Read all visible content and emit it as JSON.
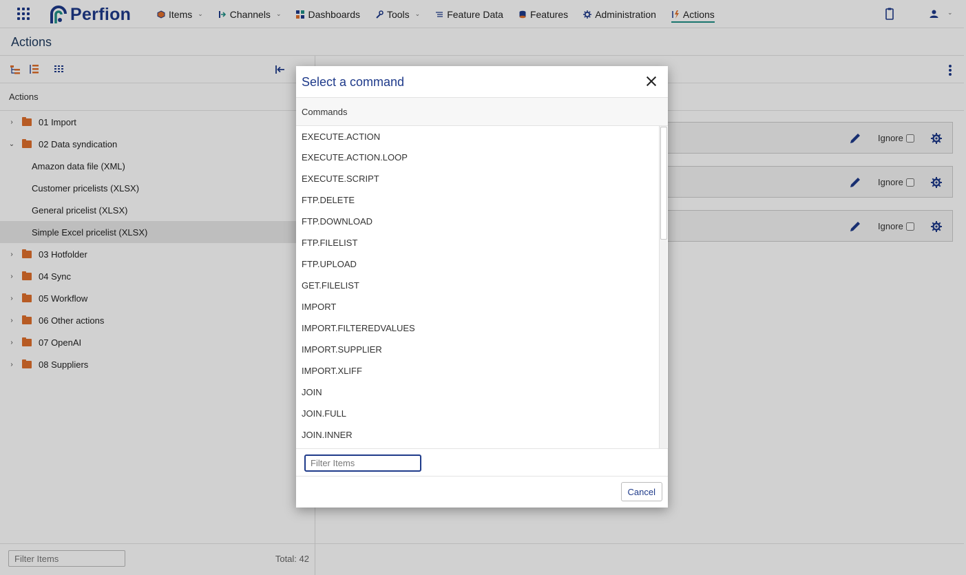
{
  "app": {
    "brand": "Perfion",
    "accent_color": "#1f8f86",
    "brand_color": "#1e3a8a"
  },
  "nav": {
    "items": [
      {
        "label": "Items",
        "icon": "cube-icon",
        "has_dropdown": true
      },
      {
        "label": "Channels",
        "icon": "channel-arrow-icon",
        "has_dropdown": true
      },
      {
        "label": "Dashboards",
        "icon": "dashboard-grid-icon",
        "has_dropdown": false
      },
      {
        "label": "Tools",
        "icon": "wrench-icon",
        "has_dropdown": true
      },
      {
        "label": "Feature Data",
        "icon": "list-icon",
        "has_dropdown": false
      },
      {
        "label": "Features",
        "icon": "database-icon",
        "has_dropdown": false
      },
      {
        "label": "Administration",
        "icon": "gear-icon",
        "has_dropdown": false
      },
      {
        "label": "Actions",
        "icon": "actions-bolt-icon",
        "has_dropdown": false,
        "active": true
      }
    ]
  },
  "page": {
    "title": "Actions"
  },
  "left_panel": {
    "header": "Actions",
    "tree": [
      {
        "label": "01 Import",
        "type": "folder",
        "expanded": false
      },
      {
        "label": "02 Data syndication",
        "type": "folder",
        "expanded": true
      },
      {
        "label": "Amazon data file (XML)",
        "type": "action"
      },
      {
        "label": "Customer pricelists (XLSX)",
        "type": "action"
      },
      {
        "label": "General pricelist (XLSX)",
        "type": "action"
      },
      {
        "label": "Simple Excel pricelist (XLSX)",
        "type": "action",
        "selected": true
      },
      {
        "label": "03 Hotfolder",
        "type": "folder",
        "expanded": false
      },
      {
        "label": "04 Sync",
        "type": "folder",
        "expanded": false
      },
      {
        "label": "05 Workflow",
        "type": "folder",
        "expanded": false
      },
      {
        "label": "06 Other actions",
        "type": "folder",
        "expanded": false
      },
      {
        "label": "07 OpenAI",
        "type": "folder",
        "expanded": false
      },
      {
        "label": "08 Suppliers",
        "type": "folder",
        "expanded": false
      }
    ],
    "filter_placeholder": "Filter Items",
    "total": "Total: 42"
  },
  "right_panel": {
    "commands": [
      {
        "ignore_label": "Ignore",
        "ignored": false
      },
      {
        "ignore_label": "Ignore",
        "ignored": false
      },
      {
        "ignore_label": "Ignore",
        "ignored": false
      }
    ]
  },
  "modal": {
    "title": "Select a command",
    "column_header": "Commands",
    "items": [
      "EXECUTE.ACTION",
      "EXECUTE.ACTION.LOOP",
      "EXECUTE.SCRIPT",
      "FTP.DELETE",
      "FTP.DOWNLOAD",
      "FTP.FILELIST",
      "FTP.UPLOAD",
      "GET.FILELIST",
      "IMPORT",
      "IMPORT.FILTEREDVALUES",
      "IMPORT.SUPPLIER",
      "IMPORT.XLIFF",
      "JOIN",
      "JOIN.FULL",
      "JOIN.INNER"
    ],
    "filter_placeholder": "Filter Items",
    "filter_value": "",
    "cancel_label": "Cancel"
  }
}
